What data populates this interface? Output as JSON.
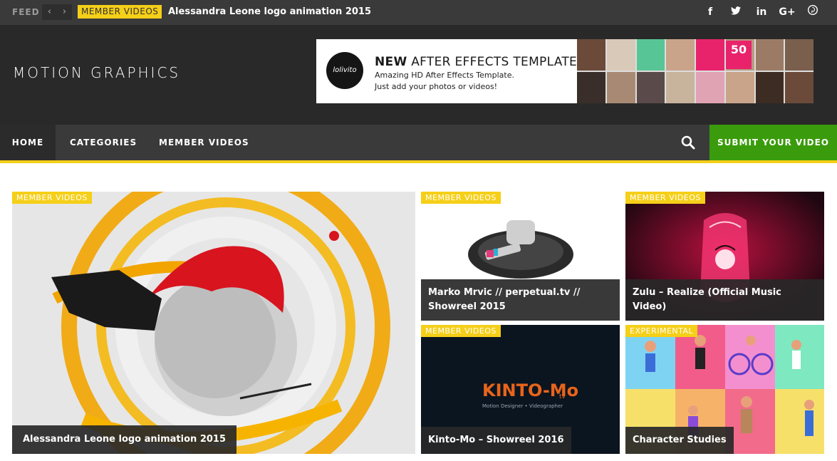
{
  "feed": {
    "label": "FEED",
    "prev_icon": "chevron-left-icon",
    "next_icon": "chevron-right-icon",
    "category": "MEMBER VIDEOS",
    "title": "Alessandra Leone logo animation 2015"
  },
  "social": [
    "f",
    "t",
    "in",
    "G+",
    "P"
  ],
  "header": {
    "logo": "MOTION GRAPHICS",
    "ad": {
      "badge": "lolivito",
      "headline_bold": "NEW",
      "headline_rest": " AFTER EFFECTS TEMPLATE",
      "line1": "Amazing HD After Effects Template.",
      "line2": "Just add your photos or videos!",
      "tile_label": "50",
      "tile_colors": [
        "#6b4a3a",
        "#d9c9b8",
        "#58c596",
        "#c9a48a",
        "#e8236b",
        "#b89a80",
        "#9c7b66",
        "#7a5f4d",
        "#3a2e2a",
        "#a88a74",
        "#5a4a4a",
        "#c8b39c",
        "#e0a3b4",
        "#c9a48a",
        "#3c2c22",
        "#6b4a3a"
      ]
    }
  },
  "nav": {
    "home": "HOME",
    "categories": "CATEGORIES",
    "member_videos": "MEMBER VIDEOS",
    "search_icon": "search-icon",
    "submit": "SUBMIT YOUR VIDEO"
  },
  "cards": [
    {
      "category": "MEMBER VIDEOS",
      "title": "Alessandra Leone logo animation 2015"
    },
    {
      "category": "MEMBER VIDEOS",
      "title": "Marko Mrvic // perpetual.tv // Showreel 2015"
    },
    {
      "category": "MEMBER VIDEOS",
      "title": "Zulu – Realize (Official Music Video)"
    },
    {
      "category": "MEMBER VIDEOS",
      "title": "Kinto-Mo – Showreel 2016"
    },
    {
      "category": "EXPERIMENTAL",
      "title": "Character Studies"
    }
  ],
  "kinto": {
    "logo": "KINTO-Mo",
    "tv": "tv",
    "tagline": "Motion Designer • Videographer"
  },
  "colors": {
    "accent": "#f5cf18",
    "submit": "#3a9c0c",
    "dark": "#292929",
    "bar": "#3a3a3a"
  }
}
